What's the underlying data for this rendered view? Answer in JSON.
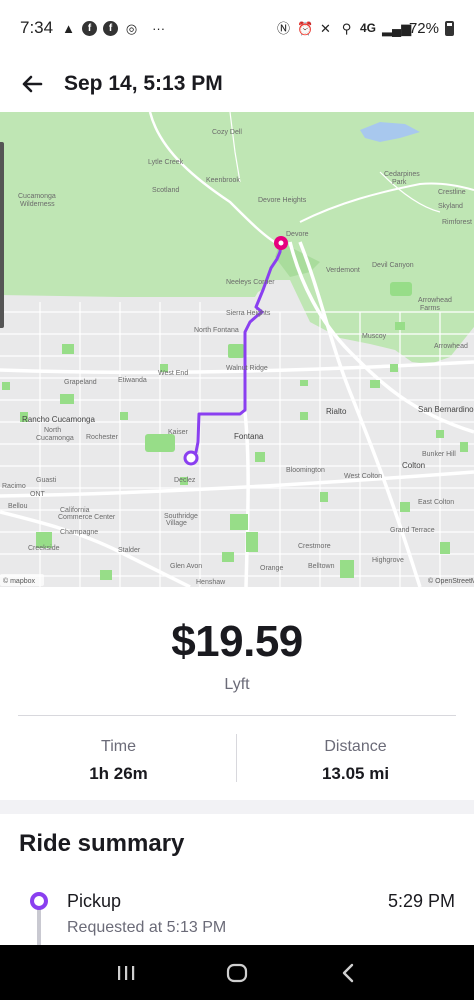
{
  "status_bar": {
    "time": "7:34",
    "network": "4G",
    "battery": "72%"
  },
  "header": {
    "title": "Sep 14, 5:13 PM",
    "back_icon": "arrow-left-icon"
  },
  "map": {
    "attribution_left": "© mapbox",
    "attribution_right": "© OpenStreetMap",
    "route_color": "#8a3ff0",
    "destination_color": "#e6007e",
    "places": {
      "cucamonga_wilderness": "Cucamonga Wilderness",
      "cozy_dell": "Cozy Dell",
      "lytle_creek": "Lytle Creek",
      "scotland": "Scotland",
      "keenbrook": "Keenbrook",
      "devore_heights": "Devore Heights",
      "devore": "Devore",
      "verdemont": "Verdemont",
      "devil_canyon": "Devil Canyon",
      "cedarpines_park": "Cedarpines Park",
      "crestline": "Crestline",
      "skyland": "Skyland",
      "rimforest": "Rimforest",
      "neelys_corner": "Neeleys Corner",
      "sierra_heights": "Sierra Heights",
      "north_fontana": "North Fontana",
      "arrowhead_farms": "Arrowhead Farms",
      "muscoy": "Muscoy",
      "arrowhead": "Arrowhead",
      "west_end": "West End",
      "walnut_ridge": "Walnut Ridge",
      "etiwanda": "Etiwanda",
      "grapeland": "Grapeland",
      "rancho_cucamonga": "Rancho Cucamonga",
      "rialto": "Rialto",
      "san_bernardino": "San Bernardino",
      "north_cucamonga": "North Cucamonga",
      "rochester": "Rochester",
      "kaiser": "Kaiser",
      "fontana": "Fontana",
      "bloomington": "Bloomington",
      "colton": "Colton",
      "bunker_hill": "Bunker Hill",
      "west_colton": "West Colton",
      "declez": "Declez",
      "guasti": "Guasti",
      "ontario": "ONT",
      "bellou": "Bellou",
      "california_commerce_center": "California Commerce Center",
      "east_colton": "East Colton",
      "southridge_village": "Southridge Village",
      "grand_terrace": "Grand Terrace",
      "champagne": "Champagne",
      "crestmore": "Crestmore",
      "creekside": "Creekside",
      "stalder": "Stalder",
      "highgrove": "Highgrove",
      "glen_avon": "Glen Avon",
      "orange": "Orange",
      "belltown": "Belltown",
      "henshaw": "Henshaw",
      "racimo": "Racimo"
    }
  },
  "fare": {
    "amount": "$19.59",
    "provider": "Lyft"
  },
  "stats": {
    "time_label": "Time",
    "time_value": "1h 26m",
    "distance_label": "Distance",
    "distance_value": "13.05 mi"
  },
  "summary": {
    "title": "Ride summary",
    "pickup_label": "Pickup",
    "pickup_time": "5:29 PM",
    "pickup_sub": "Requested at 5:13 PM"
  },
  "navbar": {
    "recent_icon": "recent-apps-icon",
    "home_icon": "home-icon",
    "back_icon": "back-chevron-icon"
  }
}
